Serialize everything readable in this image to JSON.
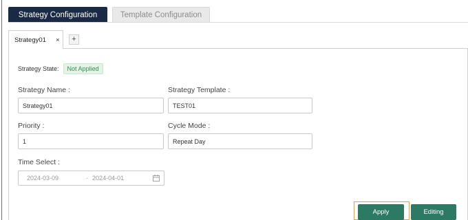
{
  "top_tabs": [
    "Strategy Configuration",
    "Template Configuration"
  ],
  "strategy_tab": {
    "label": "Strategy01",
    "close": "×",
    "add": "+"
  },
  "state": {
    "label": "Strategy State:",
    "value": "Not Applied"
  },
  "fields": {
    "strategy_name": {
      "label": "Strategy Name :",
      "value": "Strategy01"
    },
    "strategy_template": {
      "label": "Strategy Template :",
      "value": "TEST01"
    },
    "priority": {
      "label": "Priority :",
      "value": "1"
    },
    "cycle_mode": {
      "label": "Cycle Mode :",
      "value": "Repeat Day"
    },
    "time_select": {
      "label": "Time Select :",
      "start": "2024-03-09",
      "separator": "-",
      "end": "2024-04-01"
    }
  },
  "buttons": {
    "apply": "Apply",
    "editing": "Editing"
  },
  "colors": {
    "active_tab": "#1b2a44",
    "button": "#2d7a64",
    "badge_bg": "#e3f3e6",
    "badge_text": "#3a8a52",
    "highlight": "#f0a020"
  }
}
